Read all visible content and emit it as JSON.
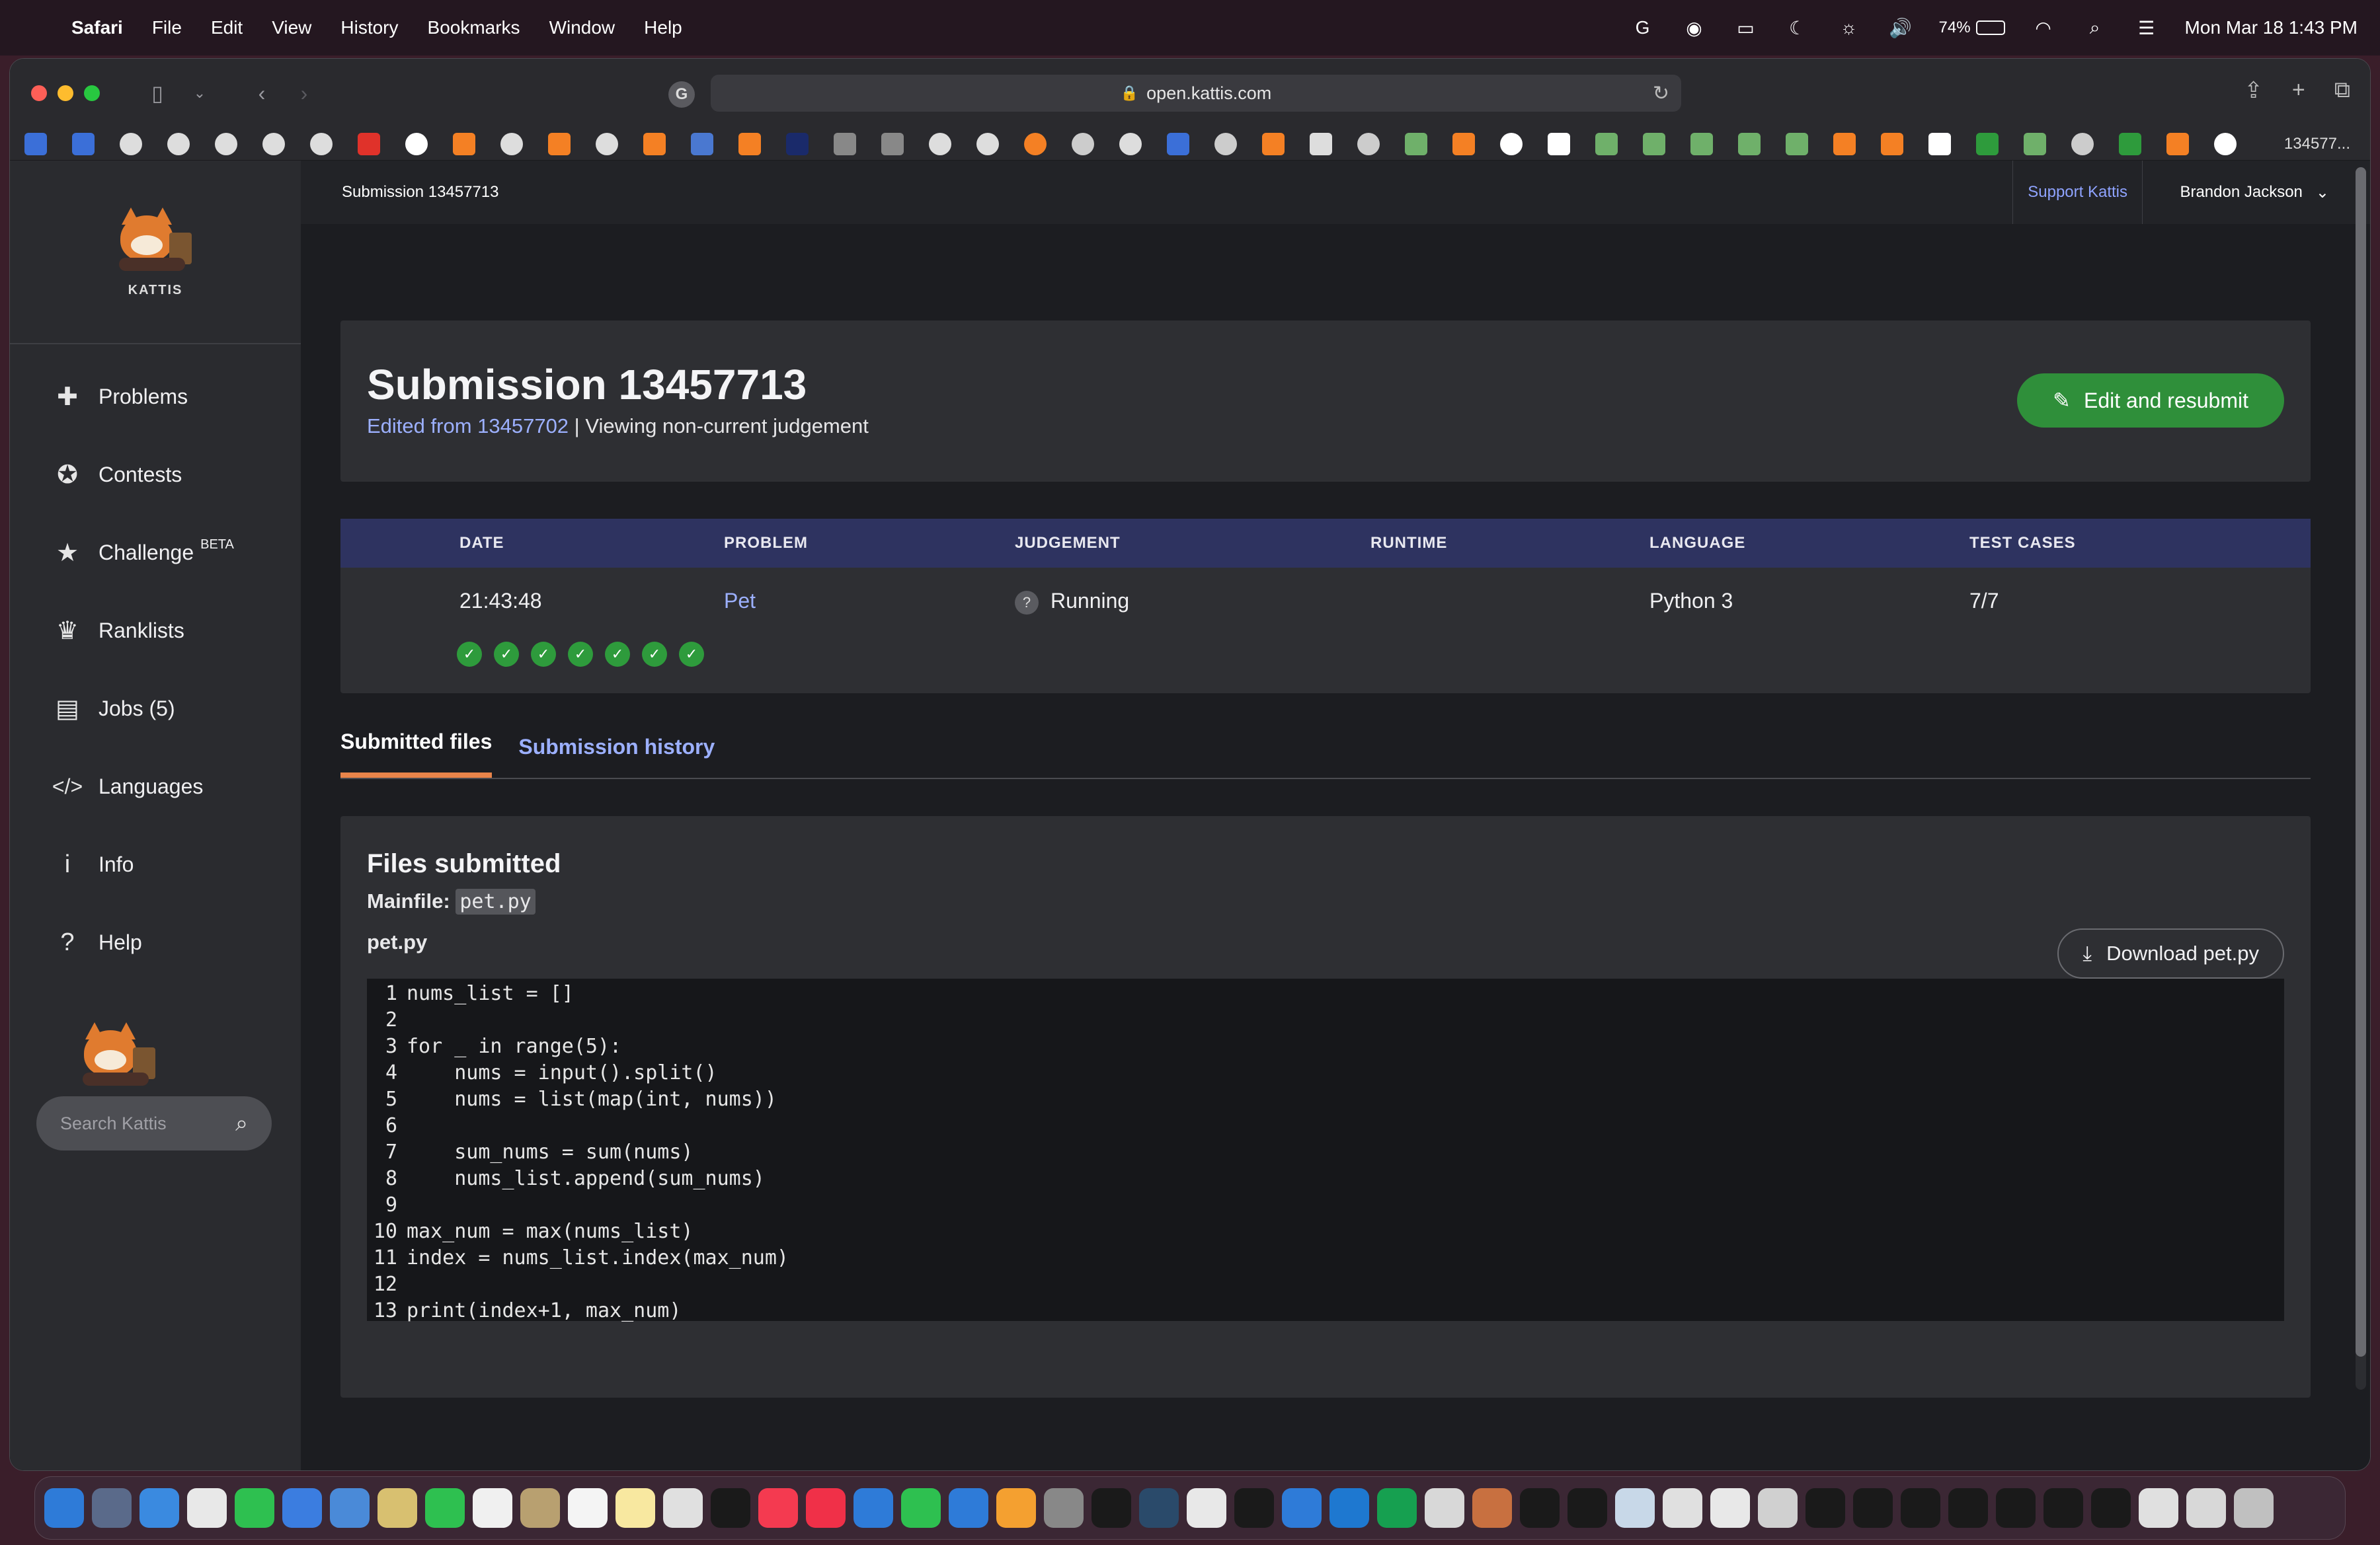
{
  "menubar": {
    "app_name": "Safari",
    "menus": [
      "File",
      "Edit",
      "View",
      "History",
      "Bookmarks",
      "Window",
      "Help"
    ],
    "battery_percent": "74%",
    "datetime": "Mon Mar 18  1:43 PM"
  },
  "browser": {
    "url": "open.kattis.com",
    "last_tab_label": "134577..."
  },
  "sidebar": {
    "logo_text": "KATTIS",
    "items": [
      {
        "label": "Problems",
        "icon": "puzzle-icon"
      },
      {
        "label": "Contests",
        "icon": "medal-icon"
      },
      {
        "label": "Challenge",
        "icon": "star-icon",
        "badge": "BETA"
      },
      {
        "label": "Ranklists",
        "icon": "trophy-icon"
      },
      {
        "label": "Jobs (5)",
        "icon": "briefcase-icon"
      },
      {
        "label": "Languages",
        "icon": "code-icon"
      },
      {
        "label": "Info",
        "icon": "info-icon"
      },
      {
        "label": "Help",
        "icon": "question-icon"
      }
    ],
    "search_placeholder": "Search Kattis"
  },
  "topbar": {
    "breadcrumb": "Submission 13457713",
    "support_label": "Support Kattis",
    "user_name": "Brandon Jackson"
  },
  "submission": {
    "title": "Submission 13457713",
    "edited_from": "Edited from 13457702",
    "viewing_note": " | Viewing non-current judgement",
    "edit_button": "Edit and resubmit"
  },
  "table": {
    "headers": {
      "date": "DATE",
      "problem": "PROBLEM",
      "judgement": "JUDGEMENT",
      "runtime": "RUNTIME",
      "language": "LANGUAGE",
      "test_cases": "TEST CASES"
    },
    "row": {
      "date": "21:43:48",
      "problem": "Pet",
      "judgement": "Running",
      "runtime": "",
      "language": "Python 3",
      "test_cases": "7/7"
    },
    "passed_tests": 7
  },
  "tabs": {
    "submitted_files": "Submitted files",
    "submission_history": "Submission history"
  },
  "files": {
    "title": "Files submitted",
    "mainfile_label": "Mainfile:",
    "mainfile_name": "pet.py",
    "filename": "pet.py",
    "download_label": "Download pet.py",
    "code": [
      {
        "n": "1",
        "text": "nums_list = []"
      },
      {
        "n": "2",
        "text": ""
      },
      {
        "n": "3",
        "text": "for _ in range(5):"
      },
      {
        "n": "4",
        "text": "    nums = input().split()"
      },
      {
        "n": "5",
        "text": "    nums = list(map(int, nums))"
      },
      {
        "n": "6",
        "text": ""
      },
      {
        "n": "7",
        "text": "    sum_nums = sum(nums)"
      },
      {
        "n": "8",
        "text": "    nums_list.append(sum_nums)"
      },
      {
        "n": "9",
        "text": ""
      },
      {
        "n": "10",
        "text": "max_num = max(nums_list)"
      },
      {
        "n": "11",
        "text": "index = nums_list.index(max_num)"
      },
      {
        "n": "12",
        "text": ""
      },
      {
        "n": "13",
        "text": "print(index+1, max_num)"
      }
    ]
  },
  "colors": {
    "accent_green": "#2f8f3a",
    "link_blue": "#9cb0ff",
    "table_header": "#2e3360",
    "tab_underline": "#e8844a"
  }
}
